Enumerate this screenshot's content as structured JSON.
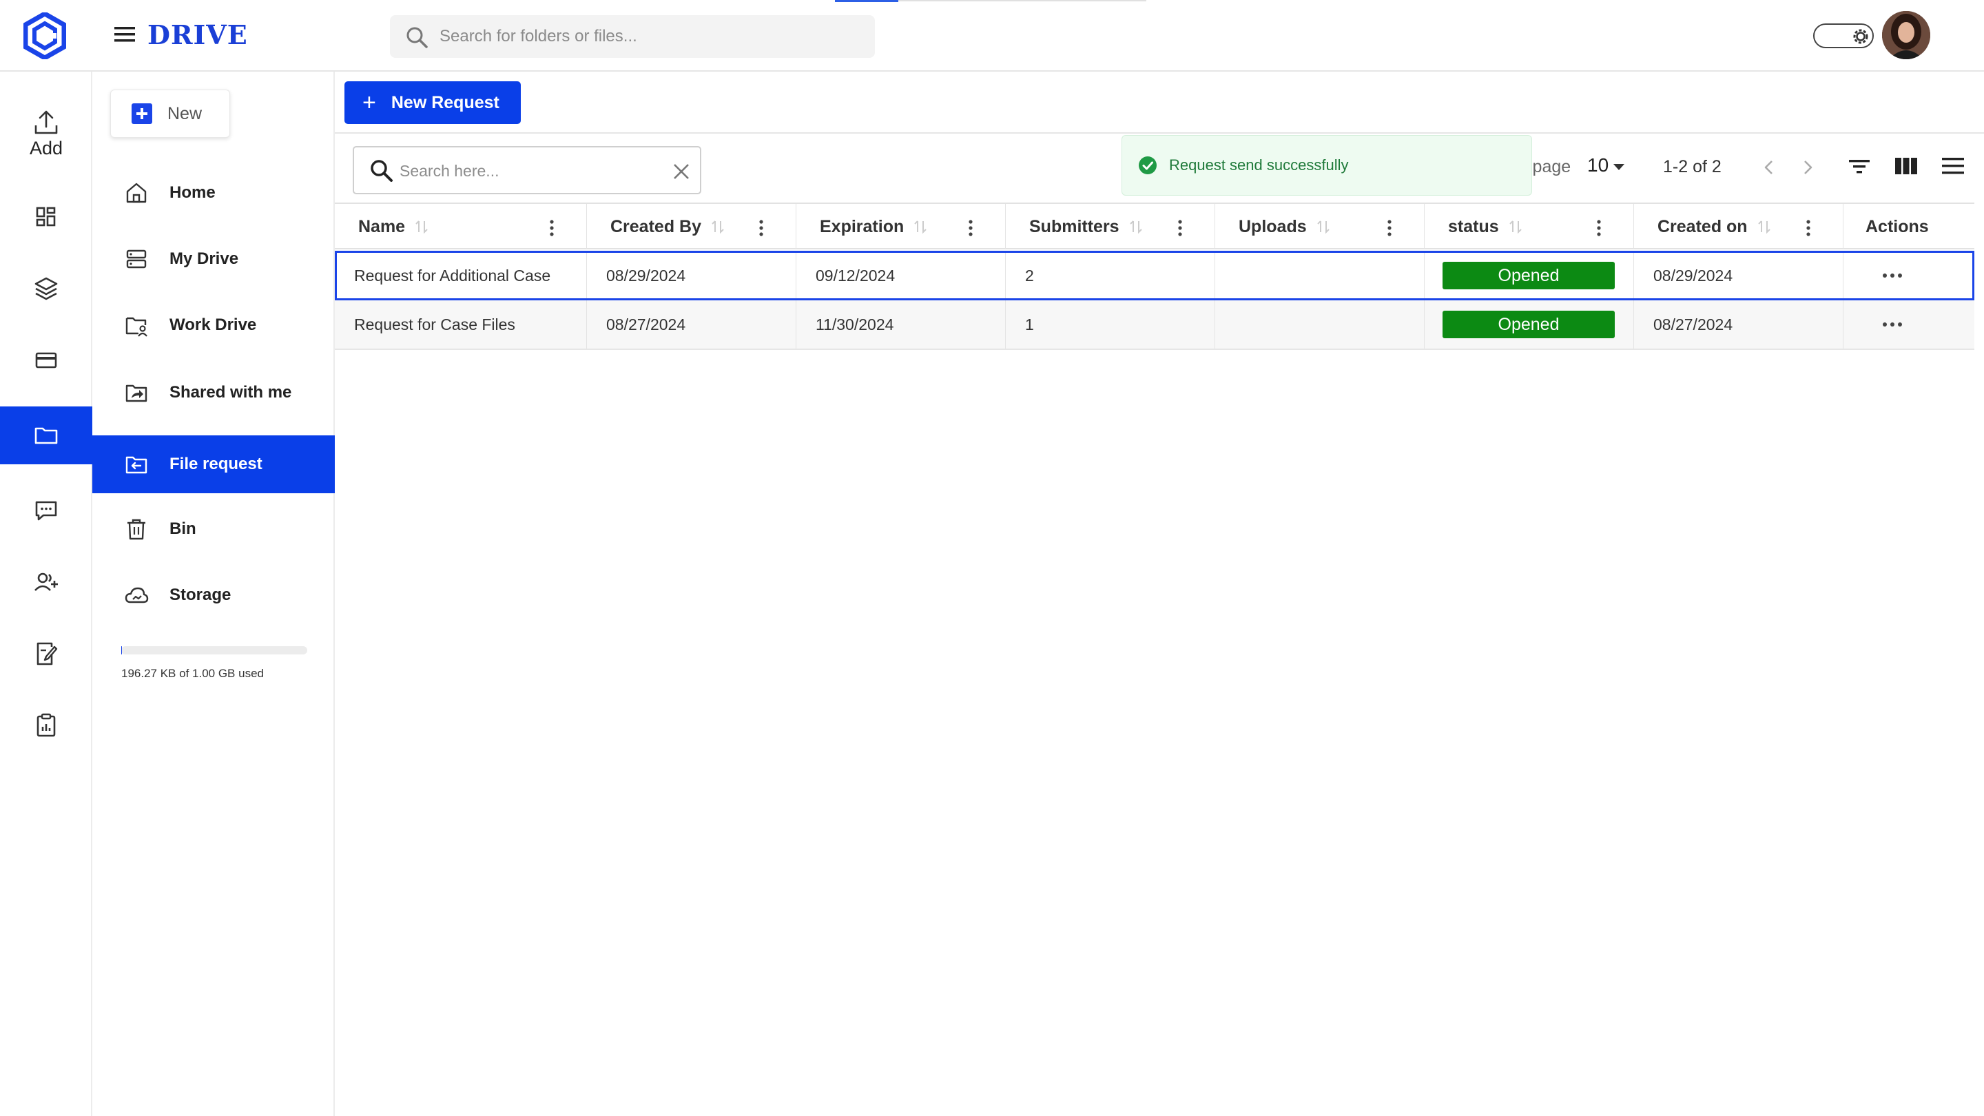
{
  "app": {
    "brand": "DRIVE",
    "top_search_placeholder": "Search for folders or files..."
  },
  "rail": {
    "add_label": "Add",
    "items": [
      "upload-icon",
      "dashboard-icon",
      "layers-icon",
      "card-icon",
      "folder-icon",
      "chat-icon",
      "user-add-icon",
      "document-edit-icon",
      "clipboard-icon"
    ],
    "active": "folder-icon"
  },
  "nav": {
    "new_label": "New",
    "items": [
      {
        "label": "Home",
        "icon": "home-icon"
      },
      {
        "label": "My Drive",
        "icon": "drive-icon"
      },
      {
        "label": "Work Drive",
        "icon": "work-drive-icon"
      },
      {
        "label": "Shared with me",
        "icon": "shared-icon"
      },
      {
        "label": "File request",
        "icon": "file-request-icon",
        "active": true
      },
      {
        "label": "Bin",
        "icon": "bin-icon"
      },
      {
        "label": "Storage",
        "icon": "cloud-icon"
      }
    ],
    "storage_used_text": "196.27 KB of 1.00 GB used",
    "storage_fraction": 0.0002
  },
  "main": {
    "new_request_label": "New Request",
    "toast_text": "Request send successfully",
    "search_placeholder": "Search here...",
    "rows_per_page_label": "Rows per page",
    "rows_per_page_value": "10",
    "range_text": "1-2 of 2"
  },
  "table": {
    "columns": [
      "Name",
      "Created By",
      "Expiration",
      "Submitters",
      "Uploads",
      "status",
      "Created on",
      "Actions"
    ],
    "rows": [
      {
        "name": "Request for Additional Case",
        "created_by": "08/29/2024",
        "expiration": "09/12/2024",
        "submitters": "2",
        "uploads": "",
        "status": "Opened",
        "created_on": "08/29/2024"
      },
      {
        "name": "Request for Case Files",
        "created_by": "08/27/2024",
        "expiration": "11/30/2024",
        "submitters": "1",
        "uploads": "",
        "status": "Opened",
        "created_on": "08/27/2024"
      }
    ]
  },
  "colors": {
    "accent": "#0a3fe8",
    "status_opened": "#0c8a13",
    "toast_bg": "#eefbf1",
    "toast_text": "#1f7a3a"
  }
}
